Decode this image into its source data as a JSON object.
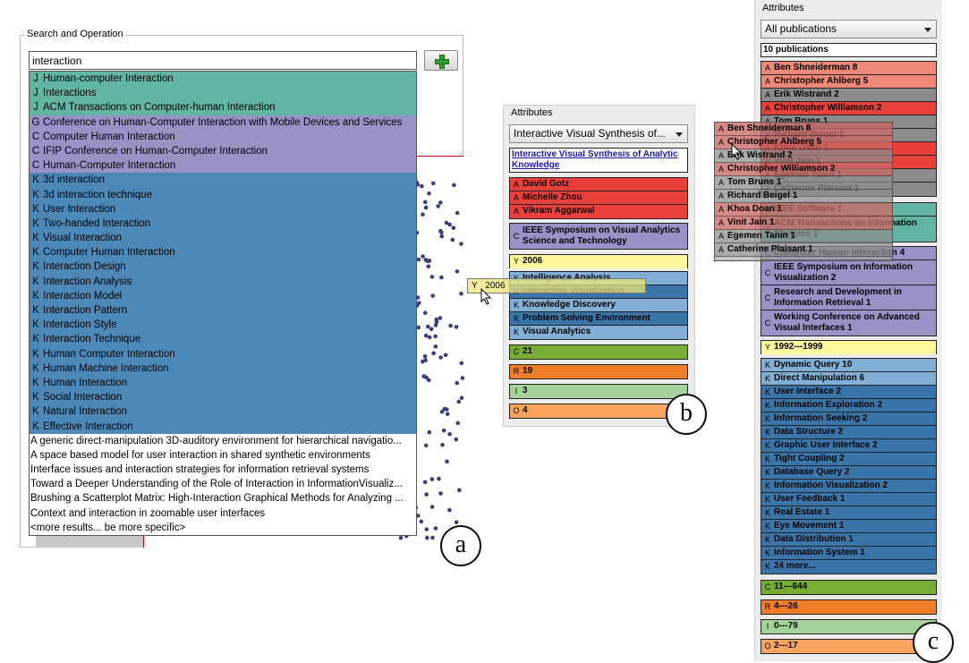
{
  "panel_a": {
    "title": "Search and Operation",
    "search_value": "interaction",
    "label": "a",
    "suggestions": [
      {
        "type": "J",
        "text": "Human-computer Interaction"
      },
      {
        "type": "J",
        "text": "Interactions"
      },
      {
        "type": "J",
        "text": "ACM Transactions on Computer-human Interaction"
      },
      {
        "type": "G",
        "text": "Conference on Human-Computer Interaction with Mobile Devices and Services"
      },
      {
        "type": "C",
        "text": "Computer Human Interaction"
      },
      {
        "type": "C",
        "text": "IFIP Conference on Human-Computer Interaction"
      },
      {
        "type": "C",
        "text": "Human-Computer Interaction"
      },
      {
        "type": "K",
        "text": "3d interaction"
      },
      {
        "type": "K",
        "text": "3d interaction technique"
      },
      {
        "type": "K",
        "text": "User Interaction"
      },
      {
        "type": "K",
        "text": "Two-handed Interaction"
      },
      {
        "type": "K",
        "text": "Visual Interaction"
      },
      {
        "type": "K",
        "text": "Computer Human Interaction"
      },
      {
        "type": "K",
        "text": "Interaction Design"
      },
      {
        "type": "K",
        "text": "Interaction Analysis"
      },
      {
        "type": "K",
        "text": "Interaction Model"
      },
      {
        "type": "K",
        "text": "Interaction Pattern"
      },
      {
        "type": "K",
        "text": "Interaction Style"
      },
      {
        "type": "K",
        "text": "Interaction Technique"
      },
      {
        "type": "K",
        "text": "Human Computer Interaction"
      },
      {
        "type": "K",
        "text": "Human Machine Interaction"
      },
      {
        "type": "K",
        "text": "Human Interaction"
      },
      {
        "type": "K",
        "text": "Social Interaction"
      },
      {
        "type": "K",
        "text": "Natural Interaction"
      },
      {
        "type": "K",
        "text": "Effective Interaction"
      },
      {
        "type": "P",
        "text": "A generic direct-manipulation 3D-auditory environment for hierarchical navigatio..."
      },
      {
        "type": "P",
        "text": "A space based model for user interaction in shared synthetic environments"
      },
      {
        "type": "P",
        "text": "Interface issues and interaction strategies for information retrieval systems"
      },
      {
        "type": "P",
        "text": "Toward a Deeper Understanding of the Role of Interaction in InformationVisualiz..."
      },
      {
        "type": "P",
        "text": "Brushing a Scatterplot Matrix: High-Interaction Graphical Methods for Analyzing ..."
      },
      {
        "type": "P",
        "text": "Context and interaction in zoomable user interfaces"
      },
      {
        "type": "P",
        "text": "<more results... be more specific>"
      }
    ]
  },
  "panel_b": {
    "title": "Attributes",
    "dropdown": "Interactive Visual Synthesis of...",
    "paper_title": "Interactive Visual Synthesis of Analytic Knowledge",
    "label": "b",
    "authors": [
      "David Gotz",
      "Michelle Zhou",
      "Vikram Aggarwal"
    ],
    "conference": "IEEE Symposium on Visual Analytics Science and Technology",
    "year": "2006",
    "keywords": [
      "Intelligence Analysis",
      "Interactive Visualization",
      "Knowledge Discovery",
      "Problem Solving Environment",
      "Visual Analytics"
    ],
    "counts": [
      {
        "type": "C",
        "text": "21"
      },
      {
        "type": "R",
        "text": "19"
      },
      {
        "type": "I",
        "text": "3"
      },
      {
        "type": "O",
        "text": "4"
      }
    ],
    "drag_year": "2006"
  },
  "panel_c": {
    "title": "Attributes",
    "dropdown": "All publications",
    "count_label": "10 publications",
    "label": "c",
    "authors": [
      {
        "text": "Ben Shneiderman 8",
        "style": "Al"
      },
      {
        "text": "Christopher Ahlberg 5",
        "style": "Al"
      },
      {
        "text": "Erik Wistrand 2",
        "style": "Ag"
      },
      {
        "text": "Christopher Williamson 2",
        "style": "A"
      },
      {
        "text": "Tom Bruns 1",
        "style": "Ag"
      },
      {
        "text": "Richard Beigel 1",
        "style": "Ag"
      },
      {
        "text": "Khoa Doan 1",
        "style": "A"
      },
      {
        "text": "Vinit Jain 1",
        "style": "A"
      },
      {
        "text": "Egemen Tanin 1",
        "style": "Ag"
      },
      {
        "text": "Catherine Plaisant 1",
        "style": "Ag"
      }
    ],
    "journals": [
      {
        "type": "J",
        "text": "IEEE Software 1"
      },
      {
        "type": "J",
        "text": "ACM Transactions on Information Systems 1"
      }
    ],
    "conferences": [
      {
        "text": "Computer Human Interaction 4"
      },
      {
        "text": "IEEE Symposium on Information Visualization 2"
      },
      {
        "text": "Research and Development in Information Retrieval 1"
      },
      {
        "text": "Working Conference on Advanced Visual Interfaces 1"
      }
    ],
    "year": "1992---1999",
    "keywords": [
      {
        "text": "Dynamic Query 10",
        "style": "Kl"
      },
      {
        "text": "Direct Manipulation 6",
        "style": "Kl"
      },
      {
        "text": "User Interface 2",
        "style": "Kd"
      },
      {
        "text": "Information Exploration 2",
        "style": "Kd"
      },
      {
        "text": "Information Seeking 2",
        "style": "Kd"
      },
      {
        "text": "Data Structure 2",
        "style": "Kd"
      },
      {
        "text": "Graphic User Interface 2",
        "style": "Kd"
      },
      {
        "text": "Tight Coupling 2",
        "style": "Kd"
      },
      {
        "text": "Database Query 2",
        "style": "Kd"
      },
      {
        "text": "Information Visualization 2",
        "style": "Kd"
      },
      {
        "text": "User Feedback 1",
        "style": "Kd"
      },
      {
        "text": "Real Estate 1",
        "style": "Kd"
      },
      {
        "text": "Eye Movement 1",
        "style": "Kd"
      },
      {
        "text": "Data Distribution 1",
        "style": "Kd"
      },
      {
        "text": "Information System 1",
        "style": "Kd"
      },
      {
        "text": "24 more...",
        "style": "Kd"
      }
    ],
    "counts": [
      {
        "type": "C",
        "text": "11---644"
      },
      {
        "type": "R",
        "text": "4---26"
      },
      {
        "type": "I",
        "text": "0---79"
      },
      {
        "type": "O",
        "text": "2---17"
      }
    ],
    "drag_overlay": [
      "Ben Shneiderman 8",
      "Christopher Ahlberg 5",
      "Erik Wistrand 2",
      "Christopher Williamson 2",
      "Tom Bruns 1",
      "Richard Beigel 1",
      "Khoa Doan 1",
      "Vinit Jain 1",
      "Egemen Tanin 1",
      "Catherine Plaisant 1"
    ]
  }
}
